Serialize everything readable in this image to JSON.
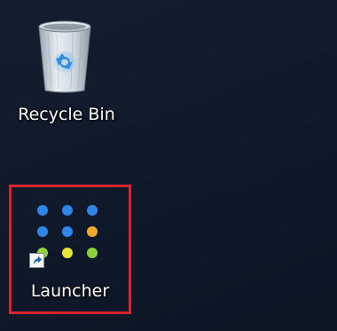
{
  "desktop": {
    "icons": [
      {
        "label": "Recycle Bin",
        "icon": "recycle-bin-icon"
      },
      {
        "label": "Launcher",
        "icon": "launcher-dots-icon",
        "badge": "shortcut-arrow-icon",
        "selected": true
      }
    ],
    "colors": {
      "background": "#121c2d",
      "selection_border": "#d9232e",
      "dot_blue": "#2f86e6",
      "dot_orange": "#f2a82a",
      "dot_yellow": "#e3e73a",
      "dot_green": "#8fd33c"
    }
  }
}
